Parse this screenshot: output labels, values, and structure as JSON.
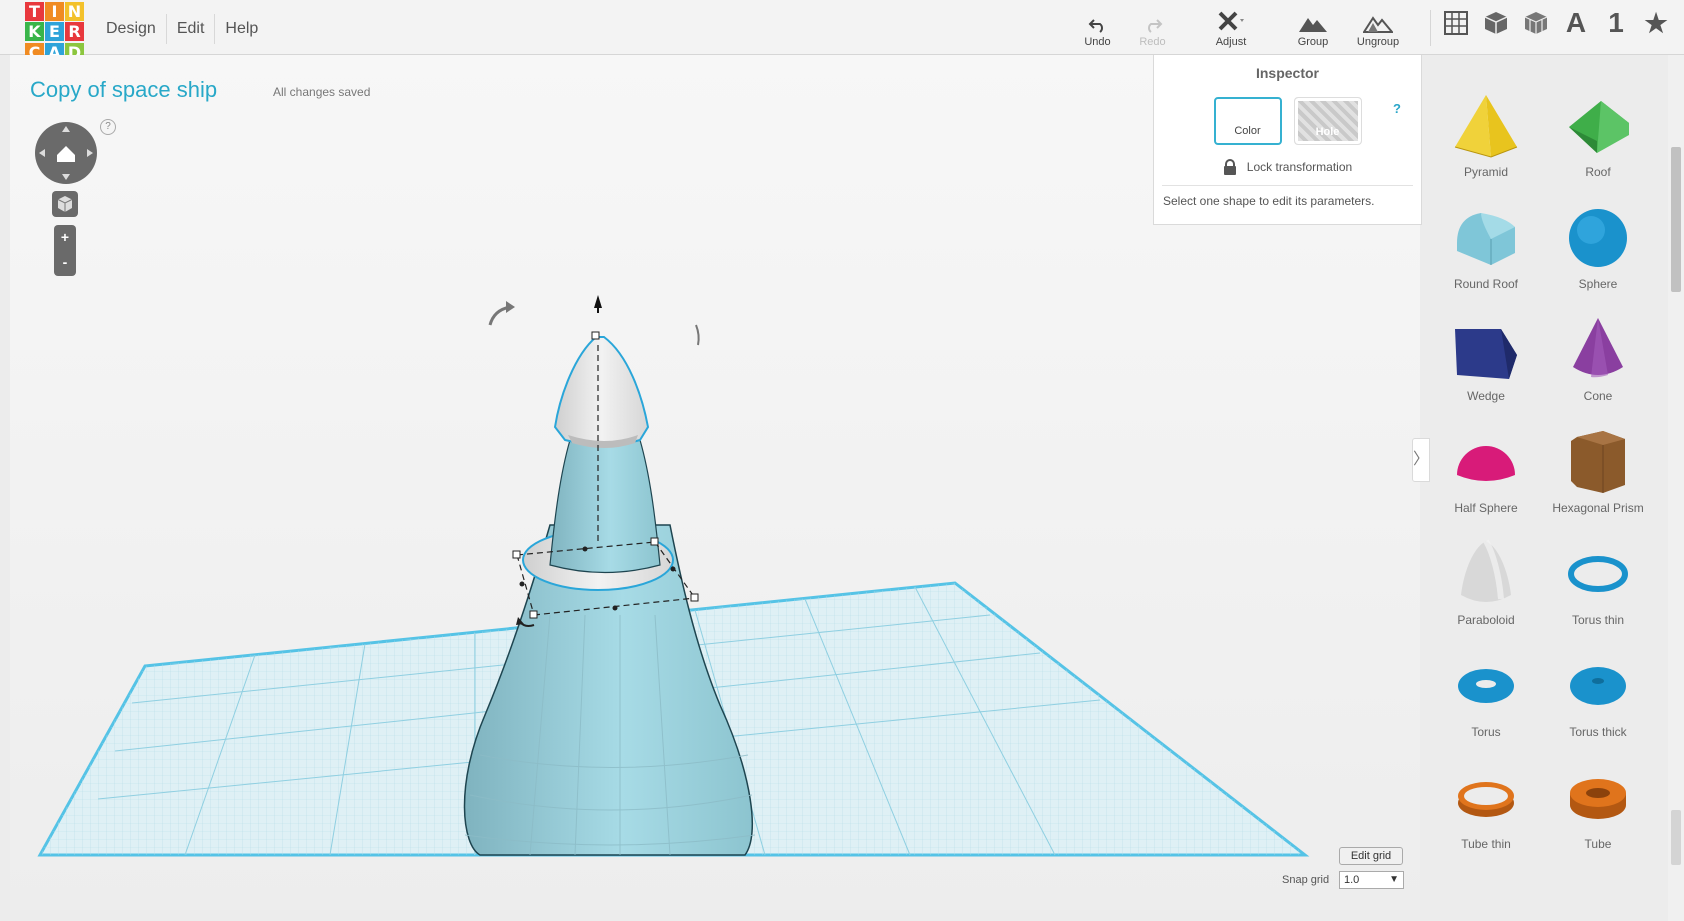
{
  "logo": {
    "letters": [
      "T",
      "I",
      "N",
      "K",
      "E",
      "R",
      "C",
      "A",
      "D"
    ],
    "colors": [
      "#e8383d",
      "#f08b22",
      "#f3c12b",
      "#39b54a",
      "#2ea3d9",
      "#e8383d",
      "#f08b22",
      "#2ea3d9",
      "#8cc63f"
    ]
  },
  "menu": {
    "items": [
      "Design",
      "Edit",
      "Help"
    ]
  },
  "toolbar": {
    "undo": "Undo",
    "redo": "Redo",
    "adjust": "Adjust",
    "group": "Group",
    "ungroup": "Ungroup"
  },
  "view_tools": {
    "text_icon": "A",
    "number_icon": "1",
    "icons": [
      "grid-view-icon",
      "box-view-icon",
      "wireframe-view-icon",
      "text-icon",
      "number-icon",
      "star-icon"
    ]
  },
  "design": {
    "title": "Copy of space ship",
    "save_status": "All changes saved"
  },
  "nav": {
    "help": "?",
    "zoom_in": "+",
    "zoom_out": "-"
  },
  "inspector": {
    "title": "Inspector",
    "color_label": "Color",
    "hole_label": "Hole",
    "help": "?",
    "lock_label": "Lock transformation",
    "message": "Select one shape to edit its parameters."
  },
  "grid": {
    "edit_label": "Edit grid",
    "snap_label": "Snap grid",
    "snap_value": "1.0"
  },
  "shapes": {
    "items": [
      {
        "label": "Pyramid",
        "color": "#e8c41e"
      },
      {
        "label": "Roof",
        "color": "#3fae49"
      },
      {
        "label": "Round Roof",
        "color": "#7fc6d8"
      },
      {
        "label": "Sphere",
        "color": "#1a92cc"
      },
      {
        "label": "Wedge",
        "color": "#2c3a8a"
      },
      {
        "label": "Cone",
        "color": "#8a3fa0"
      },
      {
        "label": "Half Sphere",
        "color": "#d81b79"
      },
      {
        "label": "Hexagonal Prism",
        "color": "#8b5a2b"
      },
      {
        "label": "Paraboloid",
        "color": "#d8d8d8"
      },
      {
        "label": "Torus thin",
        "color": "#1a92cc"
      },
      {
        "label": "Torus",
        "color": "#1a92cc"
      },
      {
        "label": "Torus thick",
        "color": "#1a92cc"
      },
      {
        "label": "Tube thin",
        "color": "#e0741c"
      },
      {
        "label": "Tube",
        "color": "#e0741c"
      }
    ]
  },
  "model": {
    "body_color": "#9ed3df",
    "cap_color": "#e6e6e6",
    "outline_color": "#2aa6d9"
  }
}
